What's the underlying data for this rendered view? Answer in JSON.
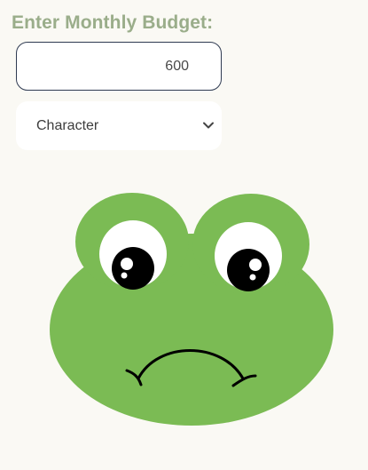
{
  "budget": {
    "label": "Enter Monthly Budget:",
    "value": "600"
  },
  "character_select": {
    "selected": "Character",
    "icon": "chevron-down-icon"
  },
  "illustration": {
    "icon": "frog-sad-icon",
    "colors": {
      "skin": "#7bbb54",
      "eye_white": "#ffffff",
      "pupil": "#000000",
      "mouth": "#000000"
    }
  },
  "colors": {
    "background": "#faf9f4",
    "label": "#9aad8a",
    "input_border": "#2f3b52"
  }
}
